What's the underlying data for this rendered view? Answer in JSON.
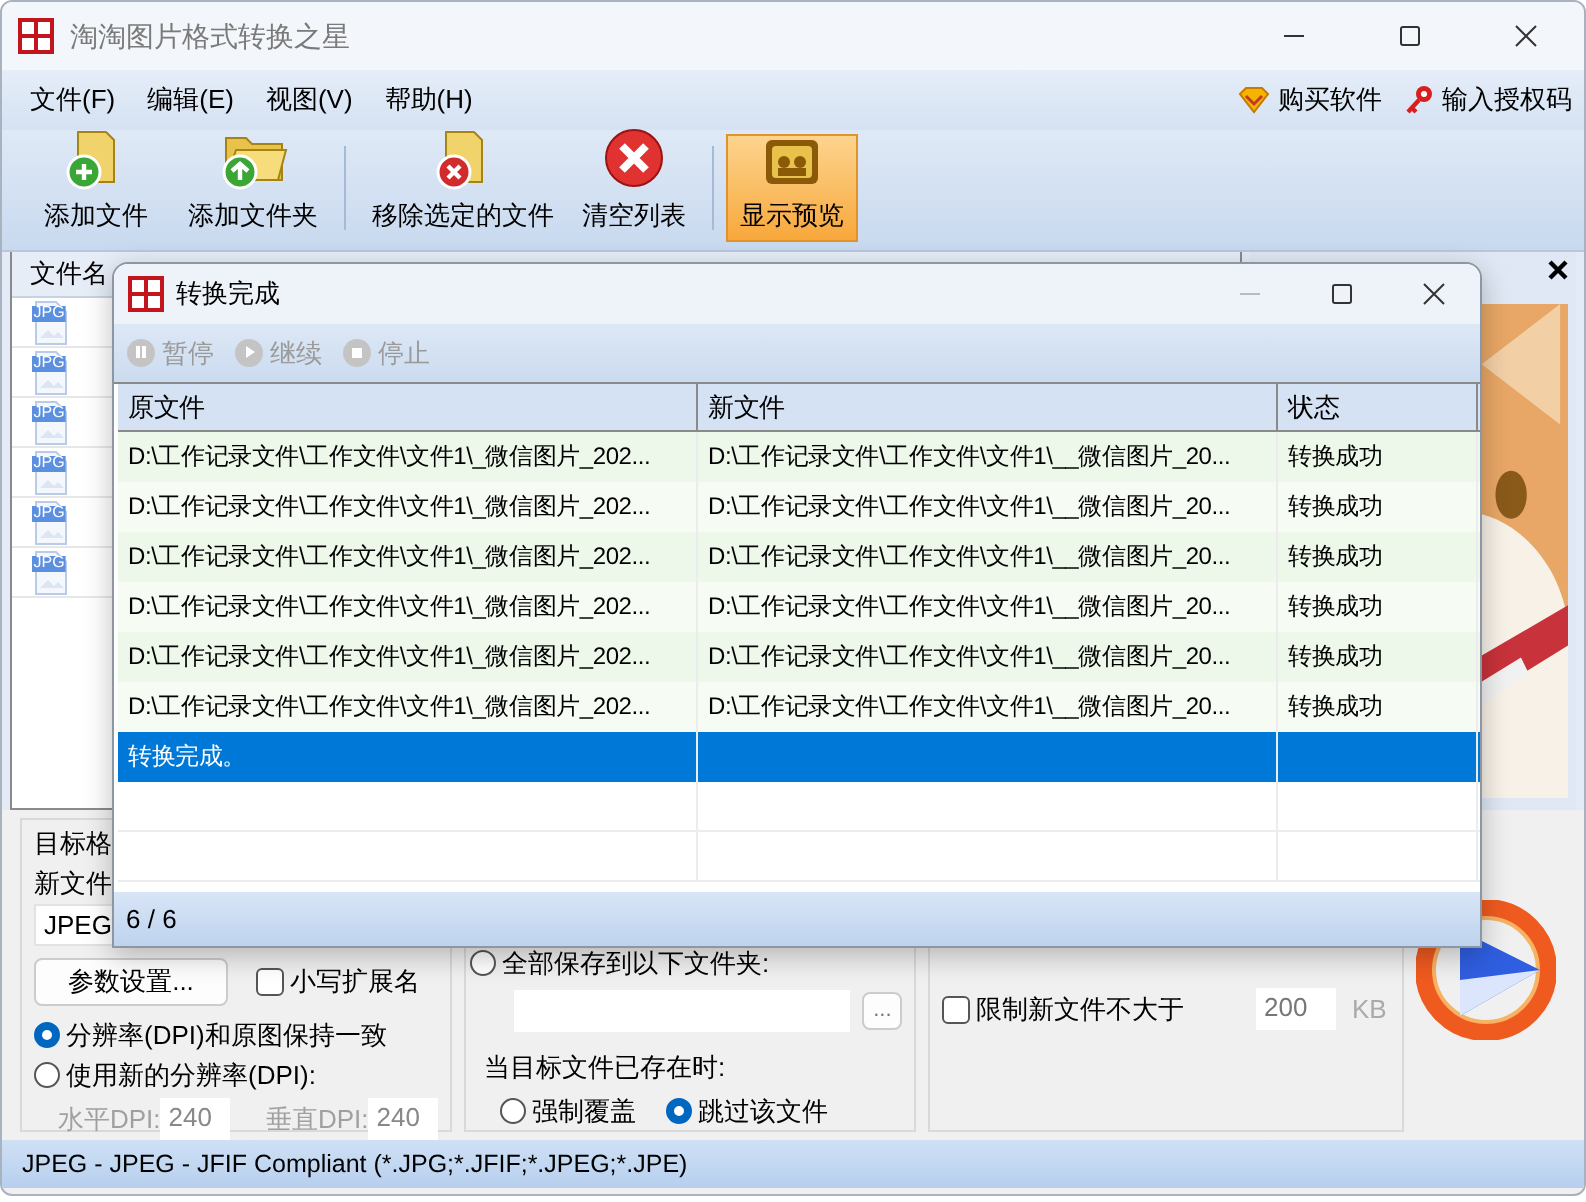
{
  "window": {
    "title": "淘淘图片格式转换之星"
  },
  "menu": [
    "文件(F)",
    "编辑(E)",
    "视图(V)",
    "帮助(H)"
  ],
  "menu_links": [
    {
      "label": "购买软件",
      "kind": "buy"
    },
    {
      "label": "输入授权码",
      "kind": "key"
    }
  ],
  "toolbar": [
    {
      "label": "添加文件",
      "kind": "add-file",
      "selected": false
    },
    {
      "label": "添加文件夹",
      "kind": "add-folder",
      "selected": false
    },
    {
      "label": "移除选定的文件",
      "kind": "remove",
      "selected": false
    },
    {
      "label": "清空列表",
      "kind": "clear",
      "selected": false
    },
    {
      "label": "显示预览",
      "kind": "preview",
      "selected": true
    }
  ],
  "file_list": {
    "columns": [
      "文件名"
    ],
    "files": [
      {
        "icon_text": "JPG"
      },
      {
        "icon_text": "JPG"
      },
      {
        "icon_text": "JPG"
      },
      {
        "icon_text": "JPG"
      },
      {
        "icon_text": "JPG"
      },
      {
        "icon_text": "JPG"
      }
    ]
  },
  "preview": {
    "kind": "picture"
  },
  "target_format": {
    "legend": "目标格",
    "format_label": "新文件",
    "format": "JPEG",
    "settings_button": "参数设置...",
    "lowercase_ext": {
      "label": "小写扩展名",
      "checked": false
    },
    "dpi_options": [
      {
        "label": "分辨率(DPI)和原图保持一致",
        "selected": true
      },
      {
        "label": "使用新的分辨率(DPI):",
        "selected": false
      }
    ],
    "dpi_fields": [
      {
        "label": "水平DPI:",
        "value": "240",
        "disabled": true
      },
      {
        "label": "垂直DPI:",
        "value": "240",
        "disabled": true
      }
    ]
  },
  "output": {
    "save_all": {
      "label": "全部保存到以下文件夹:",
      "selected": false
    },
    "browse_button": "...",
    "exists_label": "当目标文件已存在时:",
    "exists_options": [
      {
        "label": "强制覆盖",
        "selected": false
      },
      {
        "label": "跳过该文件",
        "selected": true
      }
    ]
  },
  "limits": [
    {
      "label": "限制新文件不大于",
      "checked": false,
      "value": "200",
      "unit": "KB"
    }
  ],
  "status_bar": "JPEG - JPEG - JFIF Compliant (*.JPG;*.JFIF;*.JPEG;*.JPE)",
  "dialog": {
    "title": "转换完成",
    "controls": [
      {
        "label": "暂停",
        "kind": "pause",
        "disabled": true
      },
      {
        "label": "继续",
        "kind": "resume",
        "disabled": true
      },
      {
        "label": "停止",
        "kind": "stop",
        "disabled": true
      }
    ],
    "columns": [
      "原文件",
      "新文件",
      "状态"
    ],
    "rows": [
      {
        "kind": "file",
        "cells": [
          "D:\\工作记录文件\\工作文件\\文件1\\_微信图片_202...",
          "D:\\工作记录文件\\工作文件\\文件1\\__微信图片_20...",
          "转换成功"
        ],
        "selected": false
      },
      {
        "kind": "file",
        "cells": [
          "D:\\工作记录文件\\工作文件\\文件1\\_微信图片_202...",
          "D:\\工作记录文件\\工作文件\\文件1\\__微信图片_20...",
          "转换成功"
        ],
        "selected": false
      },
      {
        "kind": "file",
        "cells": [
          "D:\\工作记录文件\\工作文件\\文件1\\_微信图片_202...",
          "D:\\工作记录文件\\工作文件\\文件1\\__微信图片_20...",
          "转换成功"
        ],
        "selected": false
      },
      {
        "kind": "file",
        "cells": [
          "D:\\工作记录文件\\工作文件\\文件1\\_微信图片_202...",
          "D:\\工作记录文件\\工作文件\\文件1\\__微信图片_20...",
          "转换成功"
        ],
        "selected": false
      },
      {
        "kind": "file",
        "cells": [
          "D:\\工作记录文件\\工作文件\\文件1\\_微信图片_202...",
          "D:\\工作记录文件\\工作文件\\文件1\\__微信图片_20...",
          "转换成功"
        ],
        "selected": false
      },
      {
        "kind": "file",
        "cells": [
          "D:\\工作记录文件\\工作文件\\文件1\\_微信图片_202...",
          "D:\\工作记录文件\\工作文件\\文件1\\__微信图片_20...",
          "转换成功"
        ],
        "selected": false
      },
      {
        "kind": "message",
        "text": "转换完成。",
        "selected": true
      }
    ],
    "footer": "6 / 6"
  }
}
